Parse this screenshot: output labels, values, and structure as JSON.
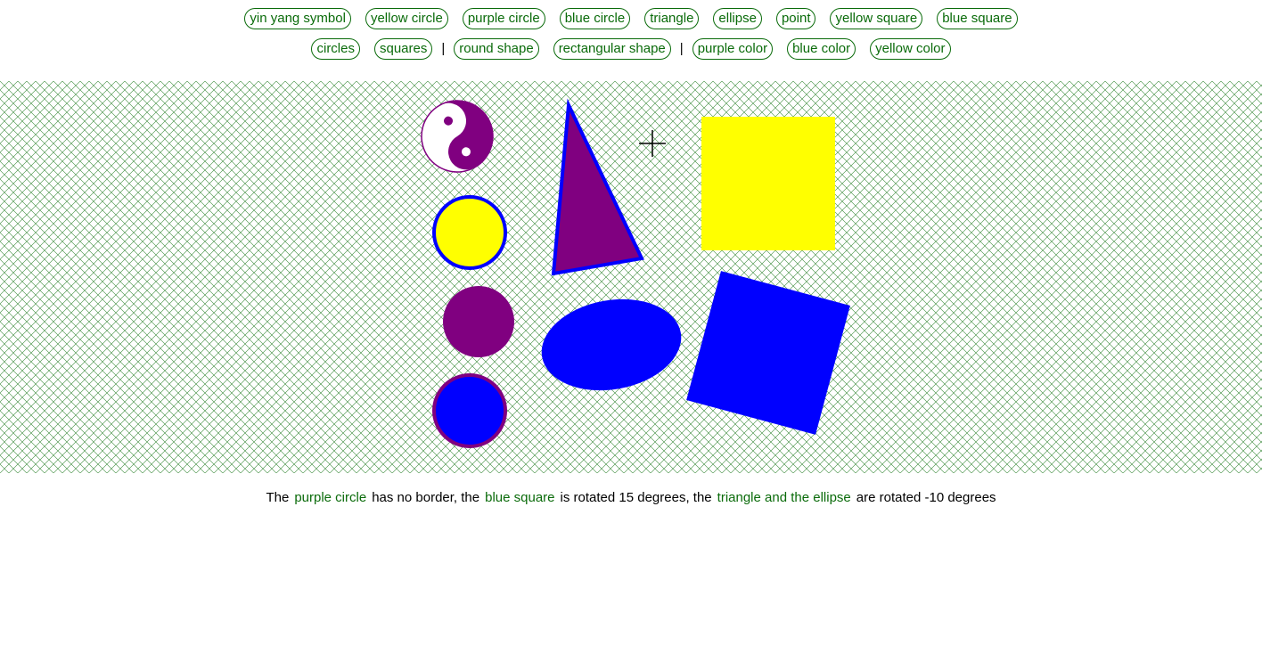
{
  "filter_buttons_row1": [
    "yin yang symbol",
    "yellow circle",
    "purple circle",
    "blue circle",
    "triangle",
    "ellipse",
    "point",
    "yellow square",
    "blue square"
  ],
  "filter_buttons_row2": {
    "groups": [
      "circles",
      "squares"
    ],
    "shapes": [
      "round shape",
      "rectangular shape"
    ],
    "colors": [
      "purple color",
      "blue color",
      "yellow color"
    ],
    "separator": "|"
  },
  "colors": {
    "accent_green": "#0a6b0a",
    "purple": "#800080",
    "yellow": "#ffff00",
    "blue": "#0000ff",
    "grid": "#3a8a3a"
  },
  "canvas_shapes": [
    "yin-yang-symbol",
    "yellow-circle",
    "purple-circle",
    "blue-circle",
    "triangle",
    "ellipse",
    "point-crosshair",
    "yellow-square",
    "blue-square"
  ],
  "caption": {
    "t1": "The",
    "l1": "purple circle",
    "t2": "has no border, the",
    "l2": "blue square",
    "t3": "is rotated 15 degrees, the",
    "l3": "triangle and the ellipse",
    "t4": "are rotated -10 degrees"
  }
}
